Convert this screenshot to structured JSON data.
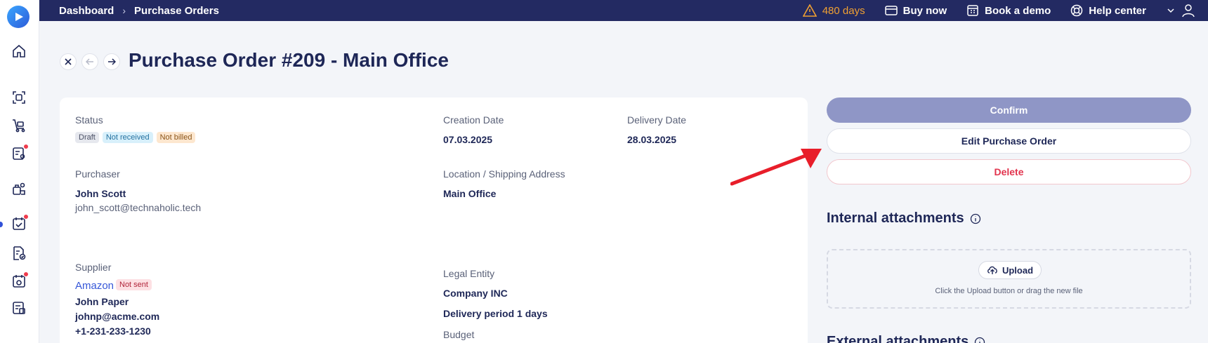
{
  "topbar": {
    "breadcrumb": [
      "Dashboard",
      "Purchase Orders"
    ],
    "trial_days": "480 days",
    "buy_now": "Buy now",
    "book_demo": "Book a demo",
    "help_center": "Help center"
  },
  "header": {
    "title": "Purchase Order #209 - Main Office"
  },
  "details": {
    "status_label": "Status",
    "status_badges": [
      "Draft",
      "Not received",
      "Not billed"
    ],
    "creation_label": "Creation Date",
    "creation_value": "07.03.2025",
    "delivery_label": "Delivery Date",
    "delivery_value": "28.03.2025",
    "purchaser_label": "Purchaser",
    "purchaser_name": "John Scott",
    "purchaser_email": "john_scott@technaholic.tech",
    "location_label": "Location / Shipping Address",
    "location_value": "Main Office",
    "supplier_label": "Supplier",
    "supplier_name": "Amazon",
    "supplier_badge": "Not sent",
    "supplier_contact": "John Paper",
    "supplier_email": "johnp@acme.com",
    "supplier_phone": "+1-231-233-1230",
    "legal_label": "Legal Entity",
    "legal_value": "Company INC",
    "delivery_period": "Delivery period 1 days",
    "budget_label": "Budget"
  },
  "actions": {
    "confirm": "Confirm",
    "edit": "Edit Purchase Order",
    "delete": "Delete"
  },
  "attachments": {
    "internal_title": "Internal attachments",
    "upload": "Upload",
    "hint": "Click the Upload button or drag the new file",
    "external_title": "External attachments"
  },
  "colors": {
    "topbar": "#232a62",
    "accent": "#3657d8",
    "danger": "#e2344e",
    "confirm": "#8f96c6",
    "annotation_arrow": "#e81e2a"
  }
}
